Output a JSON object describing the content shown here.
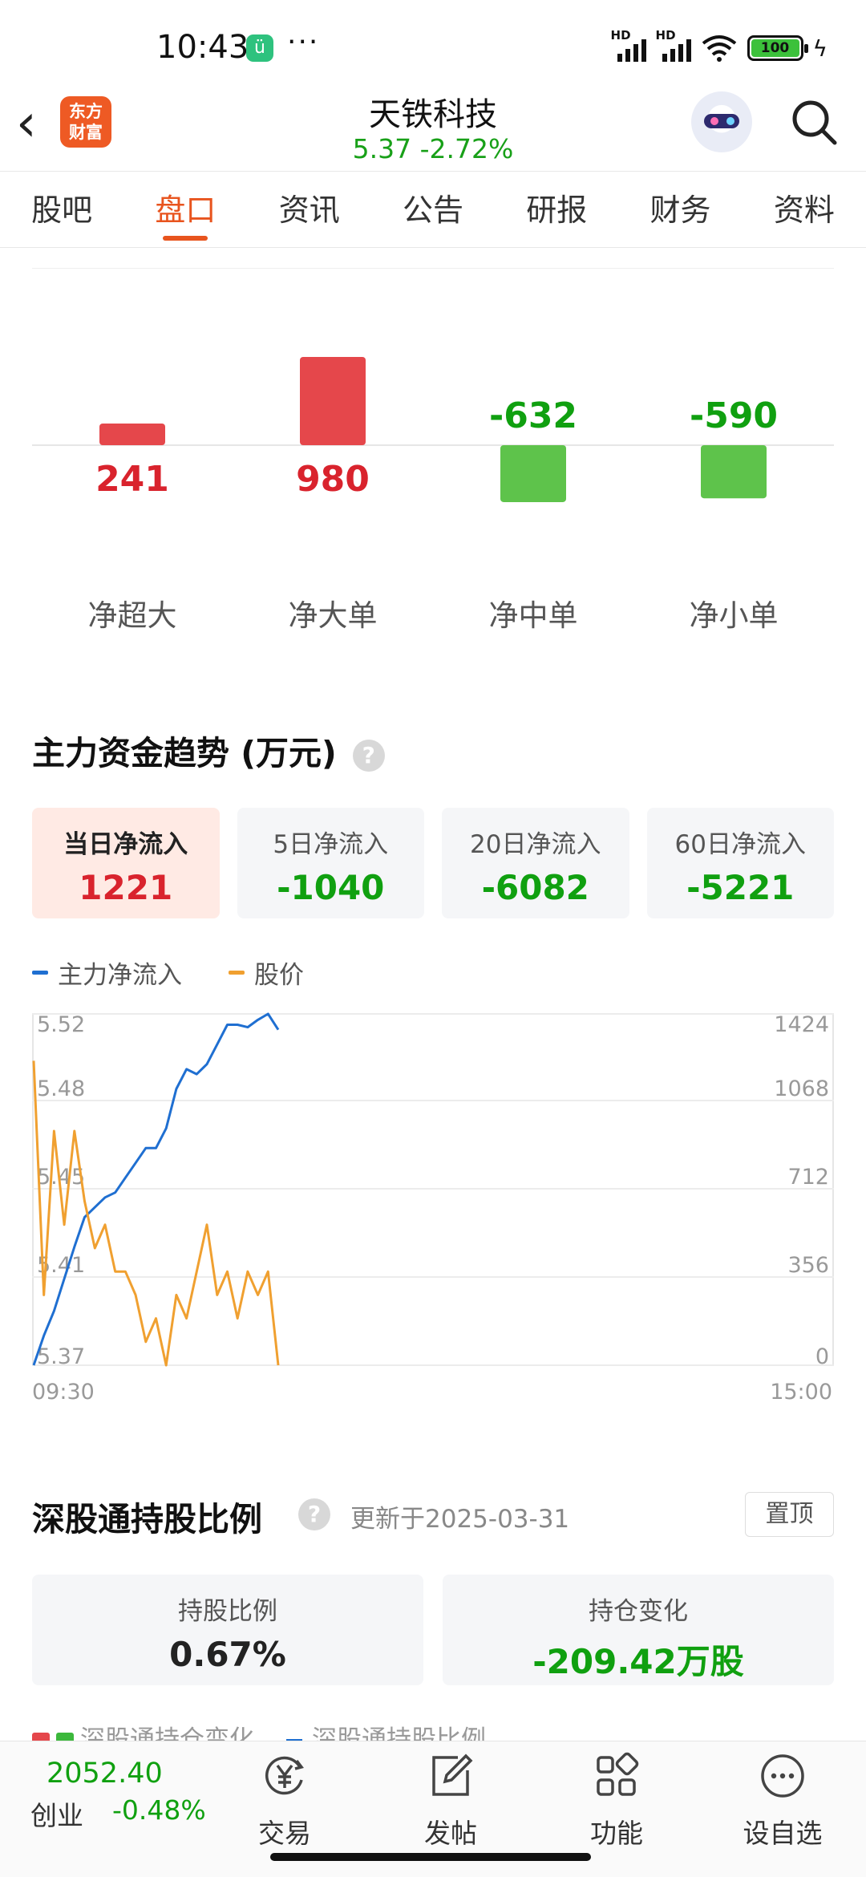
{
  "status_bar": {
    "time": "10:43",
    "app_icon": "mi-app-icon",
    "more_dots": "···",
    "network": "HD",
    "battery": "100"
  },
  "header": {
    "back_icon": "back-arrow-icon",
    "logo_text": "东方\n财富",
    "stock_name": "天铁科技",
    "price_change": "5.37   -2.72%",
    "colors": {
      "down": "#18a018",
      "up": "#d9232d",
      "accent": "#e8541e"
    }
  },
  "tabs": [
    {
      "label": "股吧",
      "active": false
    },
    {
      "label": "盘口",
      "active": true
    },
    {
      "label": "资讯",
      "active": false
    },
    {
      "label": "公告",
      "active": false
    },
    {
      "label": "研报",
      "active": false
    },
    {
      "label": "财务",
      "active": false
    },
    {
      "label": "资料",
      "active": false
    }
  ],
  "chart_data": [
    {
      "type": "bar",
      "categories": [
        "净超大",
        "净大单",
        "净中单",
        "净小单"
      ],
      "values": [
        241,
        980,
        -632,
        -590
      ],
      "data_labels": [
        "241",
        "980",
        "-632",
        "-590"
      ],
      "colors": {
        "positive": "#e5474b",
        "negative": "#5ec34b"
      }
    },
    {
      "type": "line",
      "x_ticks": [
        "09:30",
        "15:00"
      ],
      "left_axis_ticks": [
        "5.52",
        "5.48",
        "5.45",
        "5.41",
        "5.37"
      ],
      "right_axis_ticks": [
        "1424",
        "1068",
        "712",
        "356",
        "0"
      ],
      "left_axis_range": [
        5.37,
        5.52
      ],
      "right_axis_range": [
        0,
        1424
      ],
      "series": [
        {
          "name": "主力净流入",
          "axis": "right",
          "color": "#1f6fd1",
          "values": [
            0,
            120,
            220,
            350,
            480,
            600,
            640,
            680,
            700,
            760,
            820,
            880,
            880,
            960,
            1120,
            1200,
            1180,
            1220,
            1300,
            1380,
            1380,
            1370,
            1400,
            1424,
            1360
          ]
        },
        {
          "name": "股价",
          "axis": "left",
          "color": "#f0a030",
          "values": [
            5.5,
            5.4,
            5.47,
            5.43,
            5.47,
            5.44,
            5.42,
            5.43,
            5.41,
            5.41,
            5.4,
            5.38,
            5.39,
            5.37,
            5.4,
            5.39,
            5.41,
            5.43,
            5.4,
            5.41,
            5.39,
            5.41,
            5.4,
            5.41,
            5.37
          ]
        }
      ],
      "grid": true
    }
  ],
  "flow_section": {
    "title": "主力资金趋势 (万元)",
    "help_icon": "question-icon",
    "cards": [
      {
        "label": "当日净流入",
        "value": "1221",
        "trend": "up",
        "active": true
      },
      {
        "label": "5日净流入",
        "value": "-1040",
        "trend": "down",
        "active": false
      },
      {
        "label": "20日净流入",
        "value": "-6082",
        "trend": "down",
        "active": false
      },
      {
        "label": "60日净流入",
        "value": "-5221",
        "trend": "down",
        "active": false
      }
    ],
    "legend": [
      {
        "label": "主力净流入",
        "color": "#1f6fd1"
      },
      {
        "label": "股价",
        "color": "#f0a030"
      }
    ]
  },
  "hold_section": {
    "title": "深股通持股比例",
    "updated": "更新于2025-03-31",
    "pin_button": "置顶",
    "cards": [
      {
        "label": "持股比例",
        "value": "0.67%",
        "trend": "neutral"
      },
      {
        "label": "持仓变化",
        "value": "-209.42万股",
        "trend": "down"
      }
    ],
    "legend": [
      {
        "label": "深股通持仓变化"
      },
      {
        "label": "深股通持股比例"
      }
    ]
  },
  "bottom_bar": {
    "index_value": "2052.40",
    "index_name": "创业",
    "index_change": "-0.48%",
    "nav": [
      {
        "label": "交易",
        "icon": "yen-icon"
      },
      {
        "label": "发帖",
        "icon": "edit-icon"
      },
      {
        "label": "功能",
        "icon": "grid-icon"
      },
      {
        "label": "设自选",
        "icon": "more-icon"
      }
    ]
  }
}
